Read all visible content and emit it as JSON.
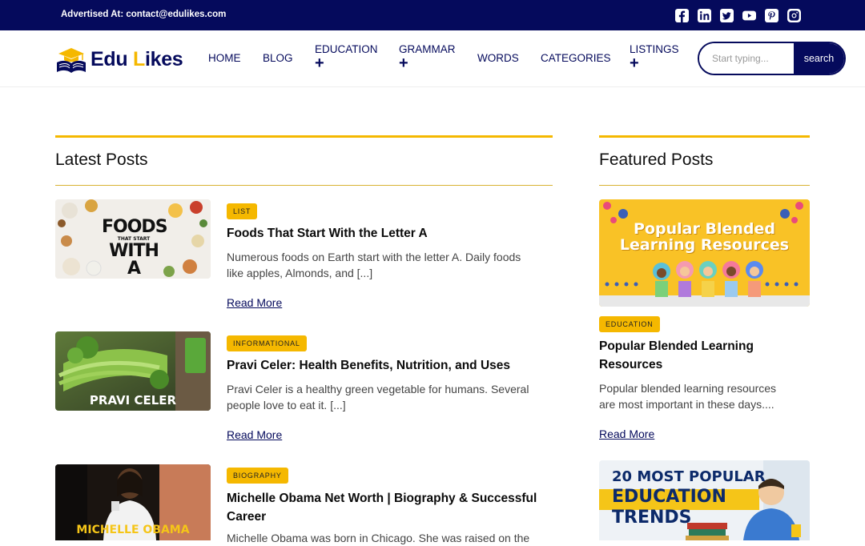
{
  "topbar": {
    "advert": "Advertised At: contact@edulikes.com",
    "social": [
      "facebook-icon",
      "linkedin-icon",
      "twitter-icon",
      "youtube-icon",
      "pinterest-icon",
      "instagram-icon"
    ]
  },
  "brand": {
    "name_part1": "Edu ",
    "name_part2": "L",
    "name_part3": "ikes"
  },
  "nav": {
    "home": "HOME",
    "blog": "BLOG",
    "education": "EDUCATION",
    "grammar": "GRAMMAR",
    "words": "WORDS",
    "categories": "CATEGORIES",
    "listings": "LISTINGS",
    "plus": "+"
  },
  "search": {
    "placeholder": "Start typing...",
    "button": "search"
  },
  "latest": {
    "title": "Latest Posts",
    "posts": [
      {
        "badge": "LIST",
        "title": "Foods That Start With the Letter A",
        "excerpt_l1": "Numerous foods on Earth start with the letter A. Daily foods",
        "excerpt_l2": "like apples, Almonds, and [...]",
        "read_more": "Read More",
        "thumb_l1": "FOODS",
        "thumb_l2": "THAT START",
        "thumb_l3": "WITH A"
      },
      {
        "badge": "INFORMATIONAL",
        "title": "Pravi Celer: Health Benefits, Nutrition, and Uses",
        "excerpt_l1": "Pravi Celer is a healthy green vegetable for humans. Several",
        "excerpt_l2": "people love to eat it. [...]",
        "read_more": "Read More",
        "thumb_l1": "PRAVI CELER"
      },
      {
        "badge": "BIOGRAPHY",
        "title_l1": "Michelle Obama Net Worth | Biography & Successful",
        "title_l2": "Career",
        "excerpt_l1": "Michelle Obama was born in Chicago. She was raised on the",
        "thumb_l1": "MICHELLE OBAMA"
      }
    ]
  },
  "featured": {
    "title": "Featured Posts",
    "posts": [
      {
        "badge": "EDUCATION",
        "title_l1": "Popular Blended Learning",
        "title_l2": "Resources",
        "excerpt_l1": "Popular blended learning resources",
        "excerpt_l2": "are most important in these days....",
        "read_more": "Read More",
        "thumb_l1": "Popular Blended",
        "thumb_l2": "Learning Resources"
      },
      {
        "thumb_l1": "20 MOST POPULAR",
        "thumb_l2": "EDUCATION",
        "thumb_l3": "TRENDS"
      }
    ]
  },
  "colors": {
    "navy": "#050a5c",
    "accent": "#f5b800"
  }
}
